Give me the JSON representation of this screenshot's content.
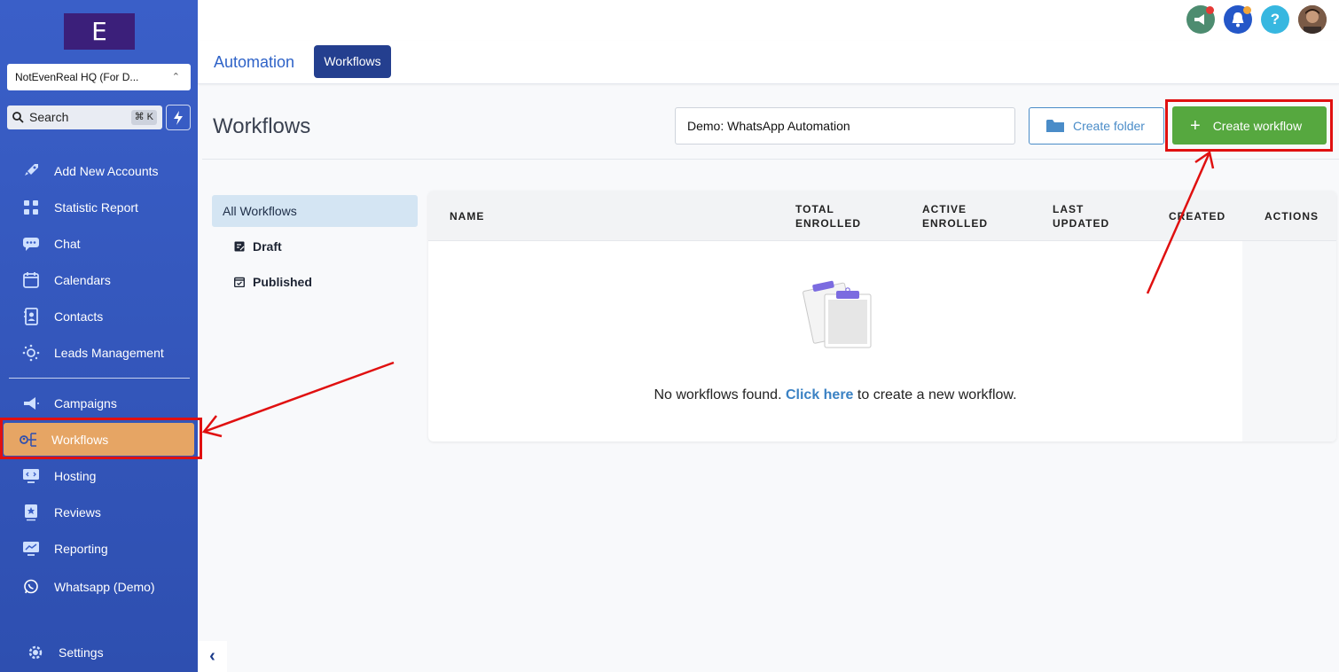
{
  "sidebar": {
    "logo": "E",
    "account": "NotEvenReal HQ (For D...",
    "search_label": "Search",
    "search_shortcut": "⌘ K",
    "items": [
      {
        "label": "Add New Accounts",
        "icon": "rocket-icon"
      },
      {
        "label": "Statistic Report",
        "icon": "grid-icon"
      },
      {
        "label": "Chat",
        "icon": "chat-icon"
      },
      {
        "label": "Calendars",
        "icon": "calendar-icon"
      },
      {
        "label": "Contacts",
        "icon": "contacts-icon"
      },
      {
        "label": "Leads Management",
        "icon": "leads-icon"
      },
      {
        "label": "Campaigns",
        "icon": "megaphone-icon"
      },
      {
        "label": "Workflows",
        "icon": "workflow-icon"
      },
      {
        "label": "Hosting",
        "icon": "hosting-icon"
      },
      {
        "label": "Reviews",
        "icon": "reviews-icon"
      },
      {
        "label": "Reporting",
        "icon": "reporting-icon"
      },
      {
        "label": "Whatsapp (Demo)",
        "icon": "whatsapp-icon"
      }
    ],
    "settings_label": "Settings",
    "collapse_glyph": "‹"
  },
  "topbar": {
    "icons": [
      "megaphone-icon",
      "bell-icon",
      "help-icon",
      "avatar"
    ],
    "help_glyph": "?"
  },
  "subnav": {
    "automation_label": "Automation",
    "workflows_label": "Workflows"
  },
  "page": {
    "title": "Workflows",
    "search_value": "Demo: WhatsApp Automation",
    "create_folder_label": "Create folder",
    "create_workflow_label": "Create workflow",
    "plus_glyph": "+"
  },
  "filters": {
    "all": "All Workflows",
    "draft": "Draft",
    "published": "Published"
  },
  "table": {
    "columns": {
      "name": "NAME",
      "total_1": "TOTAL",
      "total_2": "ENROLLED",
      "active_1": "ACTIVE",
      "active_2": "ENROLLED",
      "last_1": "LAST",
      "last_2": "UPDATED",
      "created": "CREATED",
      "actions": "ACTIONS"
    },
    "empty_prefix": "No workflows found. ",
    "empty_link": "Click here",
    "empty_suffix": " to create a new workflow."
  },
  "colors": {
    "sidebar": "#3a5fc8",
    "active_item": "#e6a564",
    "primary": "#243f8f",
    "create_button": "#56a83f",
    "annotation": "#e01010"
  }
}
